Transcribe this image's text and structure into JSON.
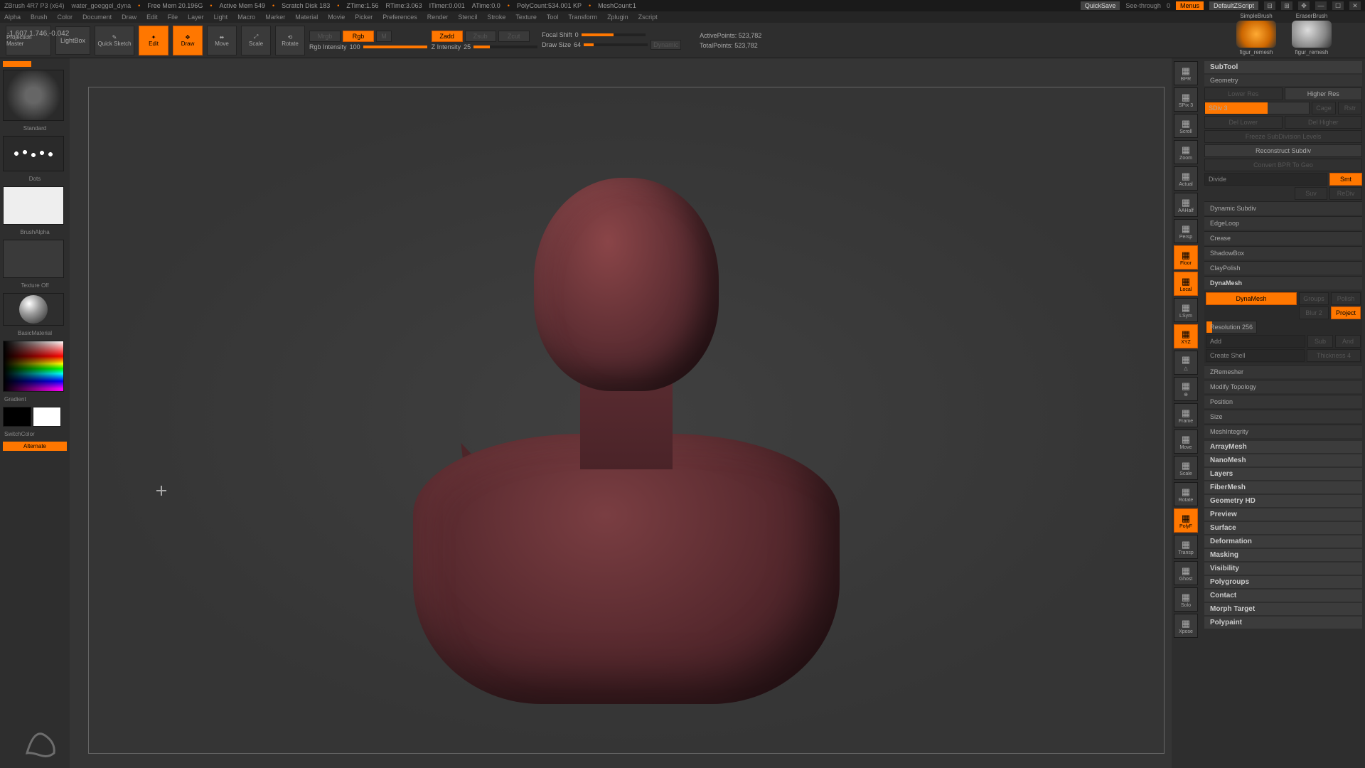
{
  "title_bar": {
    "app": "ZBrush 4R7 P3 (x64)",
    "doc": "water_goeggel_dyna",
    "free_mem": "Free Mem 20.196G",
    "active_mem": "Active Mem 549",
    "scratch": "Scratch Disk 183",
    "ztime": "ZTime:1.56",
    "rtime": "RTime:3.063",
    "itime": "ITimer:0.001",
    "atime": "ATime:0.0",
    "polycount": "PolyCount:534.001 KP",
    "meshcount": "MeshCount:1",
    "quicksave": "QuickSave",
    "see_through": "See-through",
    "see_val": "0",
    "menus": "Menus",
    "script": "DefaultZScript"
  },
  "menu_bar": [
    "Alpha",
    "Brush",
    "Color",
    "Document",
    "Draw",
    "Edit",
    "File",
    "Layer",
    "Light",
    "Macro",
    "Marker",
    "Material",
    "Movie",
    "Picker",
    "Preferences",
    "Render",
    "Stencil",
    "Stroke",
    "Texture",
    "Tool",
    "Transform",
    "Zplugin",
    "Zscript"
  ],
  "coord": "-1.607,1.746,-0.042",
  "top_shelf": {
    "proj_master": "Projection Master",
    "lightbox": "LightBox",
    "quick_sketch": "Quick Sketch",
    "edit": "Edit",
    "draw": "Draw",
    "move": "Move",
    "scale": "Scale",
    "rotate": "Rotate",
    "mrgb": "Mrgb",
    "rgb": "Rgb",
    "m": "M",
    "rgb_int": "Rgb Intensity",
    "rgb_int_val": "100",
    "zadd": "Zadd",
    "zsub": "Zsub",
    "zcut": "Zcut",
    "z_int": "Z Intensity",
    "z_int_val": "25",
    "focal": "Focal Shift",
    "focal_val": "0",
    "draw_size": "Draw Size",
    "draw_size_val": "64",
    "dynamic": "Dynamic",
    "active_pts": "ActivePoints:",
    "active_pts_val": "523,782",
    "total_pts": "TotalPoints:",
    "total_pts_val": "523,782"
  },
  "left_panel": {
    "brush_name": "Standard",
    "stroke": "Dots",
    "alpha": "BrushAlpha",
    "texture": "Texture Off",
    "material": "BasicMaterial",
    "gradient": "Gradient",
    "switch": "SwitchColor",
    "alternate": "Alternate"
  },
  "right_strip": [
    {
      "lbl": "BPR",
      "on": false
    },
    {
      "lbl": "SPix 3",
      "on": false
    },
    {
      "lbl": "Scroll",
      "on": false
    },
    {
      "lbl": "Zoom",
      "on": false
    },
    {
      "lbl": "Actual",
      "on": false
    },
    {
      "lbl": "AAHalf",
      "on": false
    },
    {
      "lbl": "Persp",
      "on": false
    },
    {
      "lbl": "Floor",
      "on": true
    },
    {
      "lbl": "Local",
      "on": true
    },
    {
      "lbl": "LSym",
      "on": false
    },
    {
      "lbl": "XYZ",
      "on": true
    },
    {
      "lbl": "△",
      "on": false
    },
    {
      "lbl": "⊕",
      "on": false
    },
    {
      "lbl": "Frame",
      "on": false
    },
    {
      "lbl": "Move",
      "on": false
    },
    {
      "lbl": "Scale",
      "on": false
    },
    {
      "lbl": "Rotate",
      "on": false
    },
    {
      "lbl": "PolyF",
      "on": true
    },
    {
      "lbl": "Transp",
      "on": false
    },
    {
      "lbl": "Ghost",
      "on": false
    },
    {
      "lbl": "Solo",
      "on": false
    },
    {
      "lbl": "Xpose",
      "on": false
    }
  ],
  "right_panel": {
    "brushes": [
      {
        "top": "SimpleBrush",
        "bot": "figur_remesh"
      },
      {
        "top": "EraserBrush",
        "bot": "figur_remesh"
      }
    ],
    "subtool": "SubTool",
    "geometry": "Geometry",
    "lower_res": "Lower Res",
    "higher_res": "Higher Res",
    "sdiv": "SDiv",
    "sdiv_val": "3",
    "cage": "Cage",
    "rstr": "Rstr",
    "del_lower": "Del Lower",
    "del_higher": "Del Higher",
    "freeze": "Freeze SubDivision Levels",
    "reconstruct": "Reconstruct Subdiv",
    "convert": "Convert BPR To Geo",
    "divide": "Divide",
    "smt": "Smt",
    "suv": "Suv",
    "rediv": "ReDiv",
    "dynamic_sub": "Dynamic Subdiv",
    "edgeloop": "EdgeLoop",
    "crease": "Crease",
    "shadowbox": "ShadowBox",
    "claypolish": "ClayPolish",
    "dynamesh_hdr": "DynaMesh",
    "dynamesh": "DynaMesh",
    "groups": "Groups",
    "polish": "Polish",
    "blur": "Blur 2",
    "project": "Project",
    "resolution": "Resolution",
    "resolution_val": "256",
    "add": "Add",
    "sub": "Sub",
    "and": "And",
    "create_shell": "Create Shell",
    "thickness": "Thickness",
    "thickness_val": "4",
    "zremesher": "ZRemesher",
    "modify_topo": "Modify Topology",
    "position": "Position",
    "size": "Size",
    "meshint": "MeshIntegrity",
    "rest": [
      "ArrayMesh",
      "NanoMesh",
      "Layers",
      "FiberMesh",
      "Geometry HD",
      "Preview",
      "Surface",
      "Deformation",
      "Masking",
      "Visibility",
      "Polygroups",
      "Contact",
      "Morph Target",
      "Polypaint"
    ]
  }
}
